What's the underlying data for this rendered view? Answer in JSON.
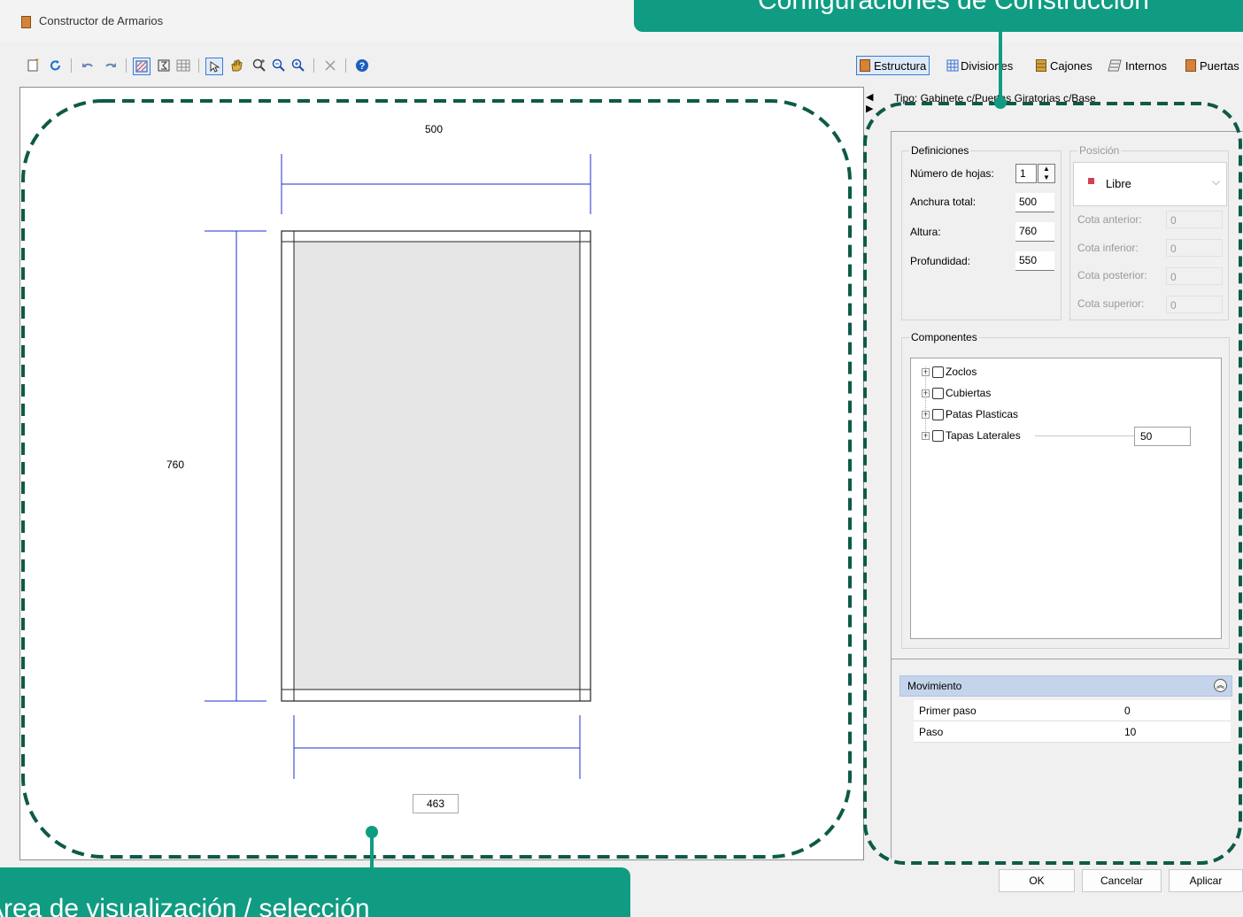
{
  "window": {
    "title": "Constructor de Armarios"
  },
  "tabs": [
    {
      "label": "Estructura"
    },
    {
      "label": "Divisiones"
    },
    {
      "label": "Cajones"
    },
    {
      "label": "Internos"
    },
    {
      "label": "Puertas"
    }
  ],
  "type_label": "Tipo: Gabinete c/Puertas Giratorias c/Base",
  "definiciones": {
    "title": "Definiciones",
    "num_hojas_label": "Número de hojas:",
    "num_hojas_value": "1",
    "anchura_label": "Anchura total:",
    "anchura_value": "500",
    "altura_label": "Altura:",
    "altura_value": "760",
    "profundidad_label": "Profundidad:",
    "profundidad_value": "550"
  },
  "posicion": {
    "title": "Posición",
    "selected": "Libre",
    "cota_anterior_label": "Cota anterior:",
    "cota_anterior_value": "0",
    "cota_inferior_label": "Cota inferior:",
    "cota_inferior_value": "0",
    "cota_posterior_label": "Cota posterior:",
    "cota_posterior_value": "0",
    "cota_superior_label": "Cota superior:",
    "cota_superior_value": "0"
  },
  "componentes": {
    "title": "Componentes",
    "items": [
      {
        "label": "Zoclos"
      },
      {
        "label": "Cubiertas"
      },
      {
        "label": "Patas Plasticas"
      },
      {
        "label": "Tapas Laterales",
        "value": "50"
      }
    ]
  },
  "movimiento": {
    "title": "Movimiento",
    "primer_paso_label": "Primer paso",
    "primer_paso_value": "0",
    "paso_label": "Paso",
    "paso_value": "10"
  },
  "drawing": {
    "width_label": "500",
    "height_label": "760",
    "inner_width_label": "463"
  },
  "buttons": {
    "ok": "OK",
    "cancel": "Cancelar",
    "apply": "Aplicar"
  },
  "callouts": {
    "top": "Configuraciones de Construcción",
    "bottom": "Área de visualización / selección"
  },
  "colors": {
    "callout": "#109c82",
    "dimension": "#1e2fd0"
  }
}
